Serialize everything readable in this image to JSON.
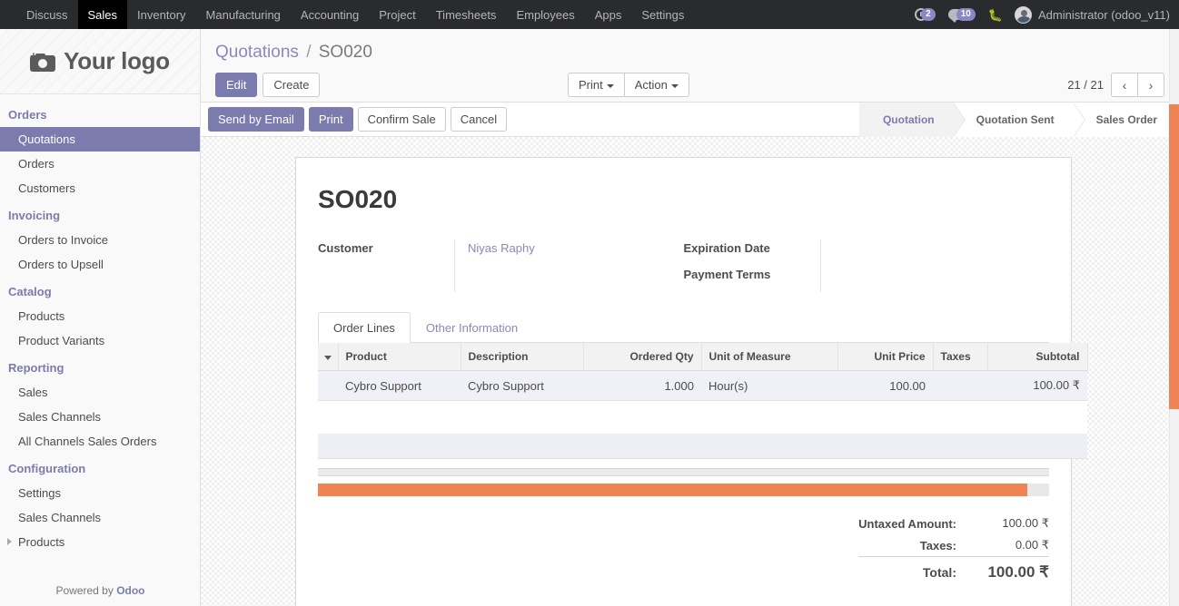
{
  "navbar": {
    "menus": [
      {
        "label": "Discuss",
        "active": false
      },
      {
        "label": "Sales",
        "active": true
      },
      {
        "label": "Inventory",
        "active": false
      },
      {
        "label": "Manufacturing",
        "active": false
      },
      {
        "label": "Accounting",
        "active": false
      },
      {
        "label": "Project",
        "active": false
      },
      {
        "label": "Timesheets",
        "active": false
      },
      {
        "label": "Employees",
        "active": false
      },
      {
        "label": "Apps",
        "active": false
      },
      {
        "label": "Settings",
        "active": false
      }
    ],
    "activity_count": "2",
    "messages_count": "10",
    "debug_icon": "bug-icon",
    "user_name": "Administrator (odoo_v11)"
  },
  "sidebar": {
    "logo_text": "Your logo",
    "logo_icon": "camera-add-icon",
    "groups": [
      {
        "title": "Orders",
        "items": [
          {
            "label": "Quotations",
            "active": true,
            "expandable": false
          },
          {
            "label": "Orders",
            "active": false,
            "expandable": false
          },
          {
            "label": "Customers",
            "active": false,
            "expandable": false
          }
        ]
      },
      {
        "title": "Invoicing",
        "items": [
          {
            "label": "Orders to Invoice",
            "active": false,
            "expandable": false
          },
          {
            "label": "Orders to Upsell",
            "active": false,
            "expandable": false
          }
        ]
      },
      {
        "title": "Catalog",
        "items": [
          {
            "label": "Products",
            "active": false,
            "expandable": false
          },
          {
            "label": "Product Variants",
            "active": false,
            "expandable": false
          }
        ]
      },
      {
        "title": "Reporting",
        "items": [
          {
            "label": "Sales",
            "active": false,
            "expandable": false
          },
          {
            "label": "Sales Channels",
            "active": false,
            "expandable": false
          },
          {
            "label": "All Channels Sales Orders",
            "active": false,
            "expandable": false
          }
        ]
      },
      {
        "title": "Configuration",
        "items": [
          {
            "label": "Settings",
            "active": false,
            "expandable": false
          },
          {
            "label": "Sales Channels",
            "active": false,
            "expandable": false
          },
          {
            "label": "Products",
            "active": false,
            "expandable": true
          }
        ]
      }
    ],
    "footer_prefix": "Powered by ",
    "footer_brand": "Odoo"
  },
  "control_panel": {
    "breadcrumb_root": "Quotations",
    "breadcrumb_sep": "/",
    "breadcrumb_current": "SO020",
    "edit_label": "Edit",
    "create_label": "Create",
    "print_label": "Print",
    "action_label": "Action",
    "pager_text": "21 / 21",
    "prev_glyph": "‹",
    "next_glyph": "›"
  },
  "statusbar": {
    "buttons": [
      {
        "label": "Send by Email",
        "primary": true
      },
      {
        "label": "Print",
        "primary": true
      },
      {
        "label": "Confirm Sale",
        "primary": false
      },
      {
        "label": "Cancel",
        "primary": false
      }
    ],
    "stages": [
      {
        "label": "Quotation",
        "active": true
      },
      {
        "label": "Quotation Sent",
        "active": false
      },
      {
        "label": "Sales Order",
        "active": false
      }
    ]
  },
  "form": {
    "title": "SO020",
    "left_fields": [
      {
        "label": "Customer",
        "value": "Niyas Raphy",
        "link": true
      }
    ],
    "right_fields": [
      {
        "label": "Expiration Date",
        "value": "",
        "link": false
      },
      {
        "label": "Payment Terms",
        "value": "",
        "link": false
      }
    ],
    "tabs": [
      {
        "label": "Order Lines",
        "active": true
      },
      {
        "label": "Other Information",
        "active": false
      }
    ],
    "table": {
      "columns": [
        {
          "label": "Product",
          "align": "left"
        },
        {
          "label": "Description",
          "align": "left"
        },
        {
          "label": "Ordered Qty",
          "align": "right"
        },
        {
          "label": "Unit of Measure",
          "align": "left"
        },
        {
          "label": "Unit Price",
          "align": "right"
        },
        {
          "label": "Taxes",
          "align": "left"
        },
        {
          "label": "Subtotal",
          "align": "right"
        }
      ],
      "rows": [
        {
          "product": "Cybro Support",
          "description": "Cybro Support",
          "ordered_qty": "1.000",
          "unit_of_measure": "Hour(s)",
          "unit_price": "100.00",
          "taxes": "",
          "subtotal": "100.00 ₹"
        }
      ]
    },
    "progress_percent": 97,
    "totals": [
      {
        "label": "Untaxed Amount:",
        "value": "100.00 ₹",
        "grand": false
      },
      {
        "label": "Taxes:",
        "value": "0.00 ₹",
        "grand": false
      },
      {
        "label": "Total:",
        "value": "100.00 ₹",
        "grand": true
      }
    ]
  },
  "colors": {
    "accent": "#7c7bad",
    "navbar_bg": "#2a2b2e",
    "scrollbar": "#ee8354",
    "badge": "#8a88c4",
    "row_bg": "#f0f0f8"
  }
}
